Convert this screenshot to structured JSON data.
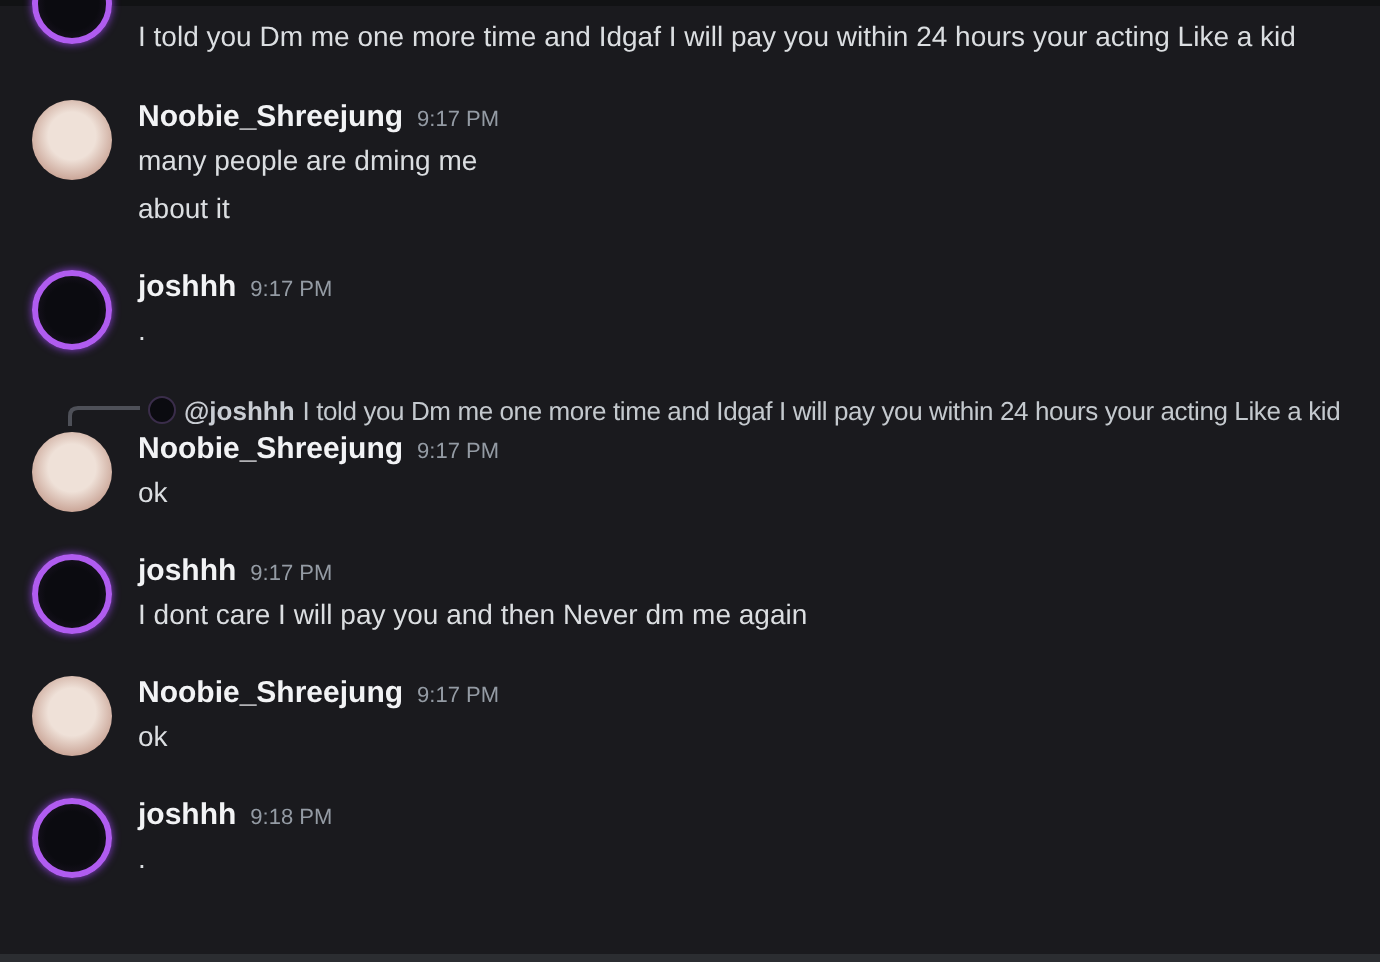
{
  "messages": [
    {
      "kind": "continuation",
      "avatar": {
        "kind": "ring"
      },
      "lines": [
        "I told you Dm me one more time and Idgaf I will pay you within 24 hours your acting Like a kid"
      ]
    },
    {
      "kind": "group",
      "avatar": {
        "kind": "photo"
      },
      "author": "Noobie_Shreejung",
      "time": "9:17 PM",
      "lines": [
        "many people are dming me",
        "about it"
      ]
    },
    {
      "kind": "group",
      "avatar": {
        "kind": "ring"
      },
      "author": "joshhh",
      "time": "9:17 PM",
      "lines": [
        "."
      ]
    },
    {
      "kind": "group",
      "avatar": {
        "kind": "photo"
      },
      "author": "Noobie_Shreejung",
      "time": "9:17 PM",
      "reply": {
        "mention": "@joshhh",
        "text": "I told you Dm me one more time and Idgaf I will pay you within 24 hours your acting Like a kid"
      },
      "lines": [
        "ok"
      ]
    },
    {
      "kind": "group",
      "avatar": {
        "kind": "ring"
      },
      "author": "joshhh",
      "time": "9:17 PM",
      "lines": [
        "I dont care I will pay you and then Never dm me again"
      ]
    },
    {
      "kind": "group",
      "avatar": {
        "kind": "photo"
      },
      "author": "Noobie_Shreejung",
      "time": "9:17 PM",
      "lines": [
        "ok"
      ]
    },
    {
      "kind": "group",
      "avatar": {
        "kind": "ring"
      },
      "author": "joshhh",
      "time": "9:18 PM",
      "lines": [
        "."
      ]
    }
  ]
}
